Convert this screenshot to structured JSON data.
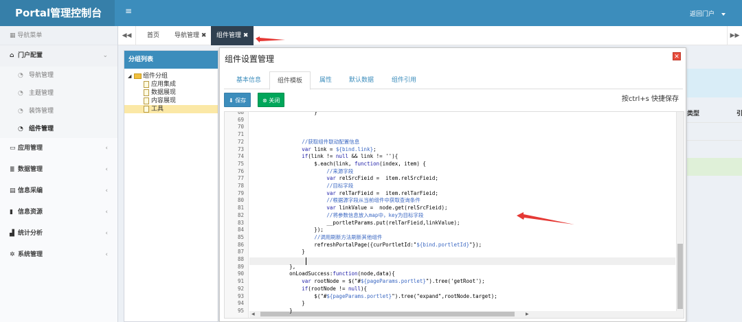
{
  "app": {
    "title": "Portal管理控制台",
    "menu_toggle": "≡",
    "user_label": "返回门户"
  },
  "sidebar": {
    "header": "导航菜单",
    "groups": [
      {
        "label": "门户配置",
        "icon": "bank-icon",
        "open": true,
        "items": [
          {
            "label": "导航管理"
          },
          {
            "label": "主题管理"
          },
          {
            "label": "装饰管理"
          },
          {
            "label": "组件管理",
            "active": true
          }
        ]
      },
      {
        "label": "应用管理",
        "icon": "laptop-icon"
      },
      {
        "label": "数据管理",
        "icon": "list-icon"
      },
      {
        "label": "信息采编",
        "icon": "newspaper-icon"
      },
      {
        "label": "信息资源",
        "icon": "book-icon"
      },
      {
        "label": "统计分析",
        "icon": "bar-chart-icon"
      },
      {
        "label": "系统管理",
        "icon": "cogs-icon"
      }
    ]
  },
  "tabbar": {
    "back": "◀◀",
    "forward": "▶▶",
    "tabs": [
      {
        "label": "首页"
      },
      {
        "label": "导航管理 ✖"
      },
      {
        "label": "组件管理 ✖",
        "active": true
      }
    ]
  },
  "background_table": {
    "col_type": "类型",
    "col_ref": "引"
  },
  "left_panel": {
    "title": "分组列表",
    "root": "组件分组",
    "children": [
      "应用集成",
      "数据展现",
      "内容展现",
      "工具"
    ],
    "selected": "工具"
  },
  "dialog": {
    "title": "组件设置管理",
    "close": "✕",
    "tabs": [
      "基本信息",
      "组件模板",
      "属性",
      "默认数据",
      "组件引用"
    ],
    "active_tab": "组件模板",
    "save_label": "⬇ 保存",
    "close_label": "⊗ 关闭",
    "hint": "按ctrl+s 快捷保存"
  },
  "code": {
    "first_line": 68,
    "lines": [
      "                    }",
      "",
      "",
      "",
      "                //获取组件联动配置信息",
      "                var link = ${bind.link};",
      "                if(link != null && link != ''){",
      "                    $.each(link, function(index, item) {",
      "                        //来源字段",
      "                        var relSrcFieid =  item.relSrcFieid;",
      "                        //目标字段",
      "                        var relTarFieid =  item.relTarFieid;",
      "                        //根据源字段从当前组件中获取查询条件",
      "                        var linkValue =  node.get(relSrcFieid);",
      "                        //将参数信息放入map中，key为目标字段",
      "                        __portletParams.put(relTarFieid,linkValue);",
      "                    });",
      "                    //调用刷新方法刷新其他组件",
      "                    refreshPortalPage({curPortletId:\"${bind.portletId}\"});",
      "                }",
      "            ",
      "            },",
      "            onLoadSuccess:function(node,data){",
      "                var rootNode = $(\"#${pageParams.portlet}\").tree('getRoot');",
      "                if(rootNode != null){",
      "                    $(\"#${pageParams.portlet}\").tree(\"expand\",rootNode.target);",
      "                }",
      "            }"
    ]
  },
  "colors": {
    "topbar": "#3c8dbc",
    "brand": "#367fa9",
    "annotation_arrow": "#e53935",
    "tab_active": "#2f4050"
  }
}
